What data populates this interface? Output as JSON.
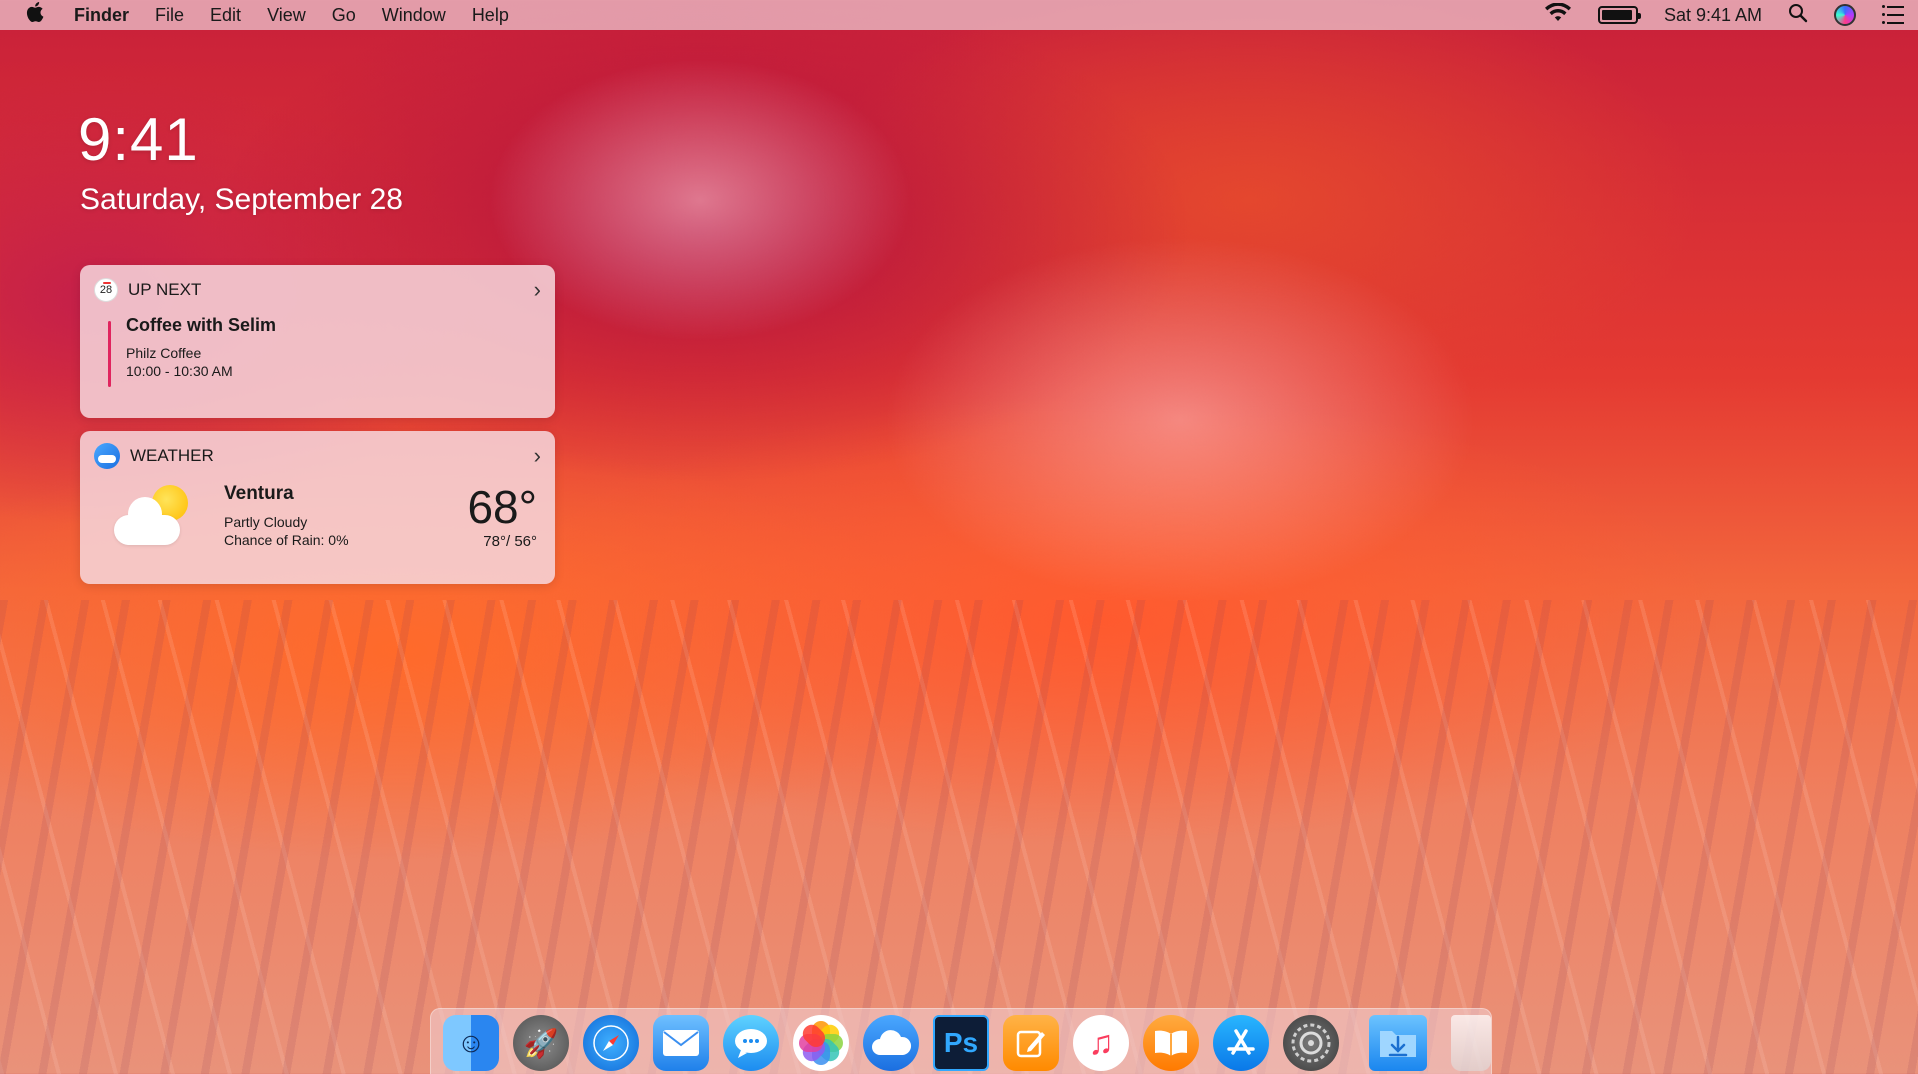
{
  "menubar": {
    "apple_icon": "apple-logo-icon",
    "app_name": "Finder",
    "menus": [
      "File",
      "Edit",
      "View",
      "Go",
      "Window",
      "Help"
    ],
    "clock": "Sat 9:41 AM",
    "status_icons": [
      "wifi-icon",
      "battery-icon",
      "search-icon",
      "siri-icon",
      "notification-center-icon"
    ]
  },
  "lock": {
    "time": "9:41",
    "date": "Saturday, September 28"
  },
  "upnext": {
    "calendar_day": "28",
    "title": "UP NEXT",
    "event": {
      "name": "Coffee with Selim",
      "location": "Philz Coffee",
      "time": "10:00 - 10:30 AM"
    },
    "accent_color": "#e0245e"
  },
  "weather": {
    "title": "WEATHER",
    "city": "Ventura",
    "condition": "Partly Cloudy",
    "rain": "Chance of Rain: 0%",
    "temp": "68°",
    "range": "78°/ 56°"
  },
  "dock": {
    "apps": [
      "Finder",
      "Launchpad",
      "Safari",
      "Mail",
      "Messages",
      "Photos",
      "iCloud",
      "Photoshop",
      "Pages",
      "Music",
      "Books",
      "App Store",
      "System Preferences",
      "Downloads",
      "Trash"
    ],
    "photoshop_label": "Ps"
  }
}
